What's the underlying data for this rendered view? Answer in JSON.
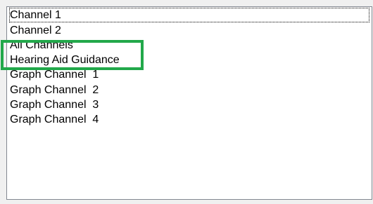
{
  "listbox": {
    "items": [
      {
        "label": "Channel 1"
      },
      {
        "label": "Channel 2"
      },
      {
        "label": "All Channels"
      },
      {
        "label": "Hearing Aid Guidance"
      },
      {
        "label": "Graph Channel  1"
      },
      {
        "label": "Graph Channel  2"
      },
      {
        "label": "Graph Channel  3"
      },
      {
        "label": "Graph Channel  4"
      }
    ]
  },
  "colors": {
    "highlight_border": "#22a84a",
    "listbox_border": "#828790",
    "background": "#f0f0f0"
  }
}
